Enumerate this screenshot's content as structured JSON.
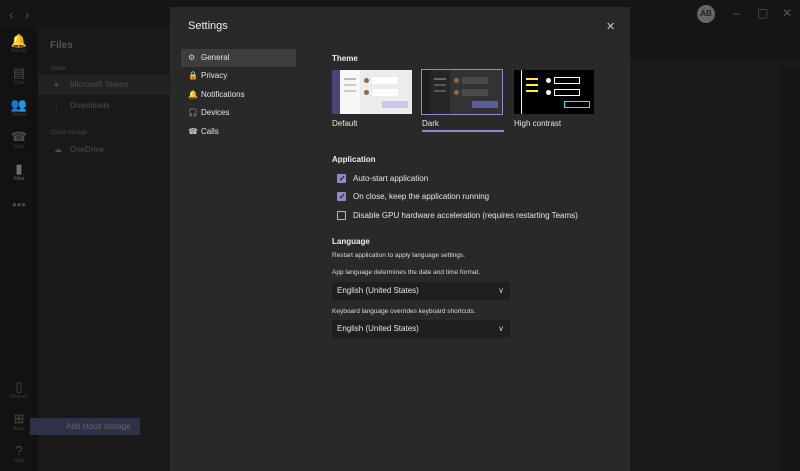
{
  "background": {
    "avatar_initials": "AB",
    "rail": [
      {
        "icon": "bell-icon",
        "glyph": "🔔",
        "label": "Activity"
      },
      {
        "icon": "chat-icon",
        "glyph": "▤",
        "label": "Chat"
      },
      {
        "icon": "teams-icon",
        "glyph": "👥",
        "label": "Teams"
      },
      {
        "icon": "calls-icon",
        "glyph": "☎",
        "label": "Calls"
      },
      {
        "icon": "files-icon",
        "glyph": "▮",
        "label": "Files"
      },
      {
        "icon": "more-icon",
        "glyph": "•••",
        "label": ""
      },
      {
        "icon": "device-icon",
        "glyph": "▯",
        "label": "Devices"
      },
      {
        "icon": "apps-icon",
        "glyph": "⊞",
        "label": "Apps"
      },
      {
        "icon": "help-icon",
        "glyph": "?",
        "label": "Help"
      }
    ],
    "files": {
      "title": "Files",
      "views_label": "Views",
      "views": [
        "Microsoft Teams",
        "Downloads"
      ],
      "cloud_label": "Cloud storage",
      "cloud": [
        "OneDrive"
      ],
      "add_storage": "Add cloud storage"
    }
  },
  "dialog": {
    "title": "Settings",
    "close_glyph": "✕",
    "nav": [
      {
        "id": "general",
        "label": "General",
        "glyph": "⚙"
      },
      {
        "id": "privacy",
        "label": "Privacy",
        "glyph": "🔒"
      },
      {
        "id": "notifications",
        "label": "Notifications",
        "glyph": "🔔"
      },
      {
        "id": "devices",
        "label": "Devices",
        "glyph": "🎧"
      },
      {
        "id": "calls",
        "label": "Calls",
        "glyph": "☎"
      }
    ],
    "selected_nav": "General"
  },
  "theme": {
    "heading": "Theme",
    "options": [
      {
        "label": "Default",
        "selected": false
      },
      {
        "label": "Dark",
        "selected": true
      },
      {
        "label": "High contrast",
        "selected": false
      }
    ]
  },
  "application": {
    "heading": "Application",
    "options": [
      {
        "label": "Auto-start application",
        "checked": true
      },
      {
        "label": "On close, keep the application running",
        "checked": true
      },
      {
        "label": "Disable GPU hardware acceleration (requires restarting Teams)",
        "checked": false
      }
    ]
  },
  "language": {
    "heading": "Language",
    "restart_note": "Restart application to apply language settings.",
    "app_language_hint": "App language determines the date and time format.",
    "app_language_value": "English (United States)",
    "keyboard_language_hint": "Keyboard language overrides keyboard shortcuts.",
    "keyboard_language_value": "English (United States)"
  },
  "colors": {
    "accent": "#8b8cc7",
    "dialog_bg": "#292929"
  }
}
